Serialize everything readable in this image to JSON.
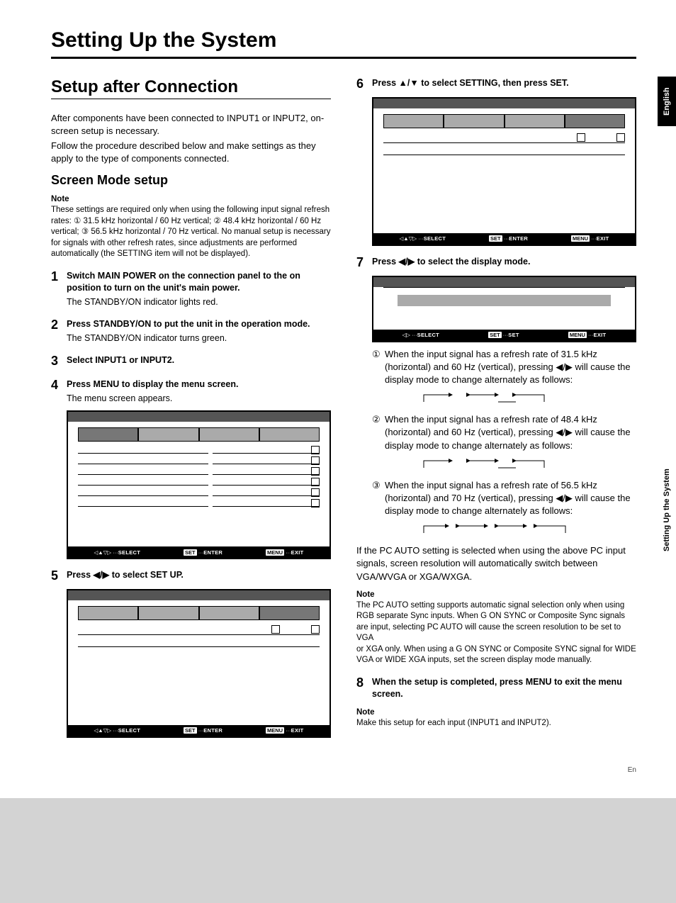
{
  "sideTabs": {
    "language": "English",
    "section": "Setting Up the System"
  },
  "mainTitle": "Setting Up the System",
  "setupTitle": "Setup after Connection",
  "intro1": "After components have been connected to INPUT1 or INPUT2, on-screen setup is necessary.",
  "intro2": "Follow the procedure described below and make settings as they apply to the type of components connected.",
  "screenModeTitle": "Screen Mode setup",
  "noteLabel": "Note",
  "screenModeNote": "These settings are required only when using the following input signal refresh rates: ① 31.5 kHz horizontal / 60 Hz vertical; ② 48.4 kHz horizontal / 60 Hz vertical; ③ 56.5 kHz horizontal / 70 Hz vertical. No manual setup is necessary for signals with other refresh rates, since adjustments are performed automatically (the SETTING item will not be displayed).",
  "steps": {
    "s1": {
      "num": "1",
      "bold": "Switch MAIN POWER on the connection panel to the on position to turn on the unit's main power.",
      "plain": "The STANDBY/ON indicator lights red."
    },
    "s2": {
      "num": "2",
      "bold": "Press STANDBY/ON to put the unit in the operation mode.",
      "plain": "The STANDBY/ON indicator turns green."
    },
    "s3": {
      "num": "3",
      "bold": "Select INPUT1 or INPUT2."
    },
    "s4": {
      "num": "4",
      "bold": "Press MENU to display the menu screen.",
      "plain": "The menu screen appears."
    },
    "s5": {
      "num": "5",
      "bold": "Press ◀/▶ to select SET UP."
    },
    "s6": {
      "num": "6",
      "bold": "Press ▲/▼ to select SETTING, then press SET."
    },
    "s7": {
      "num": "7",
      "bold": "Press ◀/▶ to select the display mode."
    },
    "s8": {
      "num": "8",
      "bold": "When the setup is completed, press MENU to exit the menu screen."
    }
  },
  "subItems": {
    "i1": "When the input signal has a refresh rate of 31.5 kHz (horizontal) and 60 Hz (vertical), pressing ◀/▶ will cause the display mode to change alternately as follows:",
    "i2": "When the input signal has a refresh rate of 48.4 kHz (horizontal) and 60 Hz (vertical), pressing ◀/▶ will cause the display mode to change alternately as follows:",
    "i3": "When the input signal has a refresh rate of 56.5 kHz (horizontal) and 70 Hz (vertical), pressing ◀/▶ will cause the display mode to change alternately as follows:"
  },
  "pcAuto": "If the PC AUTO setting is selected when using the above PC input signals, screen resolution will automatically switch between VGA/WVGA or XGA/WXGA.",
  "pcAutoNote": "The PC AUTO setting supports automatic signal selection only when using RGB separate Sync inputs. When G ON SYNC or Composite Sync signals are input, selecting PC AUTO will cause the screen resolution to be set to VGA\nor XGA only. When using a G ON SYNC or Composite SYNC signal for WIDE VGA or WIDE XGA inputs, set the screen display mode manually.",
  "finalNote": "Make this setup for each input (INPUT1 and INPUT2).",
  "footer": {
    "select": "SELECT",
    "enter": "ENTER",
    "exit": "EXIT",
    "set": "SET",
    "setBtn": "SET",
    "menuBtn": "MENU"
  },
  "pageNum": {
    "label": "En"
  },
  "circled": {
    "c1": "①",
    "c2": "②",
    "c3": "③"
  }
}
